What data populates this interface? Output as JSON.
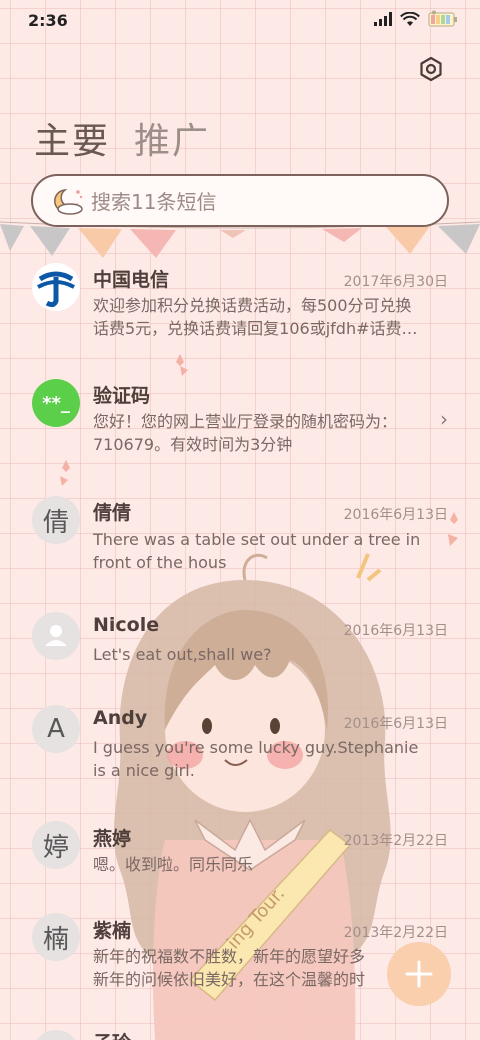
{
  "status_bar": {
    "time": "2:36"
  },
  "tabs": [
    {
      "label": "主要"
    },
    {
      "label": "推广"
    }
  ],
  "search": {
    "placeholder": "搜索11条短信"
  },
  "messages": [
    {
      "name": "中国电信",
      "date": "2017年6月30日",
      "avatar_type": "china-telecom-logo",
      "line1": "欢迎参加积分兑换话费活动，每500分可兑换",
      "line2": "话费5元，兑换话费请回复106或jfdh#话费…"
    },
    {
      "name": "验证码",
      "date": "",
      "avatar_type": "verification-code",
      "avatar_text": "**_",
      "line1": "您好！您的网上营业厅登录的随机密码为：",
      "line2": "710679。有效时间为3分钟"
    },
    {
      "name": "倩倩",
      "date": "2016年6月13日",
      "avatar_text": "倩",
      "line1": "There was a table set out under a tree in",
      "line2": "front of the hous"
    },
    {
      "name": "Nicole",
      "date": "2016年6月13日",
      "avatar_type": "person-icon",
      "line1": "Let's eat out,shall we?",
      "line2": ""
    },
    {
      "name": "Andy",
      "date": "2016年6月13日",
      "avatar_text": "A",
      "line1": "I guess you're some lucky guy.Stephanie",
      "line2": "is a nice girl."
    },
    {
      "name": "燕婷",
      "date": "2013年2月22日",
      "avatar_text": "婷",
      "line1": "嗯。收到啦。同乐同乐",
      "line2": ""
    },
    {
      "name": "紫楠",
      "date": "2013年2月22日",
      "avatar_text": "楠",
      "line1": "新年的祝福数不胜数，新年的愿望好多",
      "line2": "新年的问候依旧美好，在这个温馨的时"
    },
    {
      "name": "子玲",
      "date": "",
      "avatar_text": "",
      "line1": "",
      "line2": ""
    }
  ],
  "sash_text": "ing Tour.",
  "colors": {
    "background": "#fde9e6",
    "grid": "#eebeba",
    "verification_green": "#5ccf4a",
    "fab": "#f9cfae",
    "telecom_blue": "#0d58a6"
  },
  "icons": [
    "settings-icon",
    "search-icon",
    "add-icon",
    "chevron-right-icon",
    "person-icon"
  ]
}
